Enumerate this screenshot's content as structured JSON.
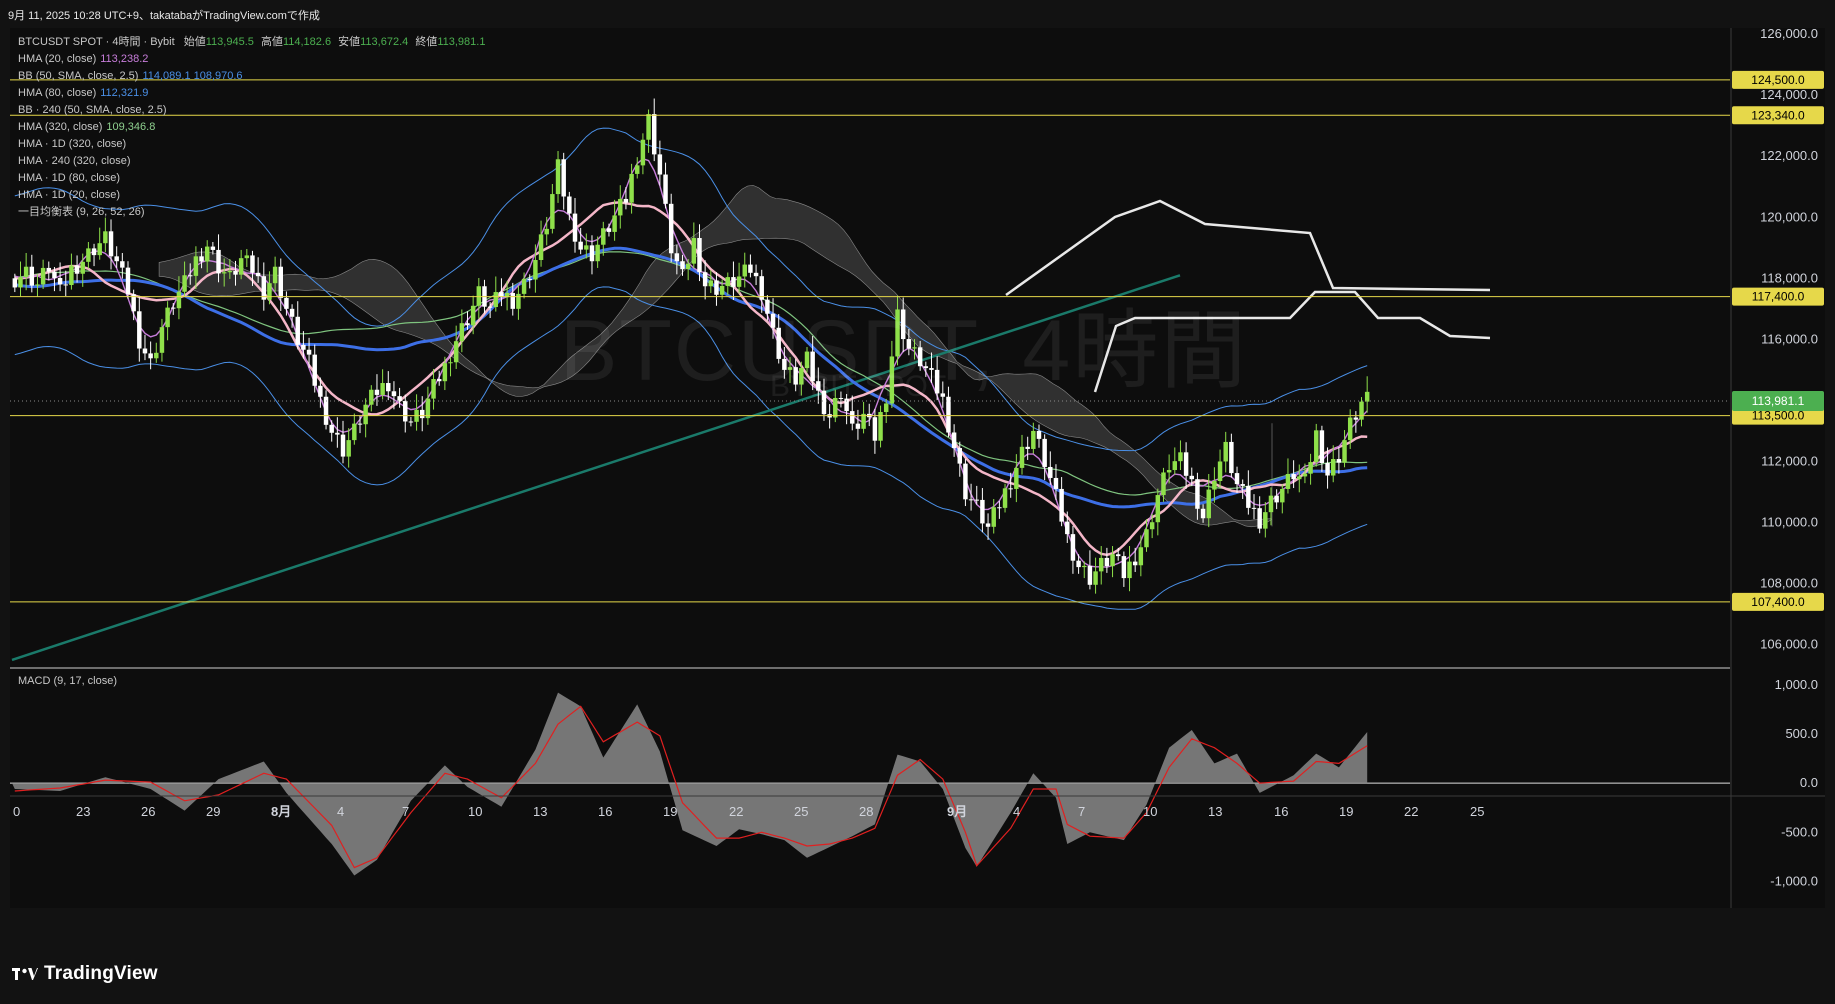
{
  "header": {
    "created_text": "9月 11, 2025 10:28 UTC+9、takatabaがTradingView.comで作成"
  },
  "symbol": {
    "title": "BTCUSDT SPOT · 4時間 · Bybit",
    "open_label": "始値",
    "open": "113,945.5",
    "high_label": "高値",
    "high": "114,182.6",
    "low_label": "安値",
    "low": "113,672.4",
    "close_label": "終値",
    "close": "113,981.1"
  },
  "watermark": {
    "main": "BTCUSDT, 4時間",
    "sub": "BYBIT SPOT"
  },
  "indicators": [
    {
      "label": "HMA (20, close)",
      "value": "113,238.2",
      "color": "#c77dda"
    },
    {
      "label": "BB (50, SMA, close, 2.5)",
      "value": "114,089.1  108,970.6",
      "color": "#4a8fe6"
    },
    {
      "label": "HMA (80, close)",
      "value": "112,321.9",
      "color": "#4a8fe6"
    },
    {
      "label": "BB · 240 (50, SMA, close, 2.5)",
      "value": "",
      "color": "#c8c8c8"
    },
    {
      "label": "HMA (320, close)",
      "value": "109,346.8",
      "color": "#8fd08f"
    },
    {
      "label": "HMA · 1D (320, close)",
      "value": "",
      "color": "#c8c8c8"
    },
    {
      "label": "HMA · 240 (320, close)",
      "value": "",
      "color": "#c8c8c8"
    },
    {
      "label": "HMA · 1D (80, close)",
      "value": "",
      "color": "#c8c8c8"
    },
    {
      "label": "HMA · 1D (20, close)",
      "value": "",
      "color": "#c8c8c8"
    },
    {
      "label": "一目均衡表 (9, 26, 52, 26)",
      "value": "",
      "color": "#c8c8c8"
    }
  ],
  "macd_label": "MACD (9, 17, close)",
  "footer": {
    "brand": "TradingView"
  },
  "colors": {
    "up": "#8fe04a",
    "down": "#ffffff",
    "hline": "#e6d84a",
    "hma_fast": "#c77dda",
    "hma_slow": "#3d6fe6",
    "hma_pink": "#f4b6c8",
    "bb": "#4a8fe6",
    "green_ma": "#7fc47f",
    "teal": "#1a7a6a",
    "cloud": "#5a5a5a",
    "white_proj": "#e8e8e8",
    "macd_signal": "#e02020",
    "macd_hist": "#8a8a8a",
    "price_badge": "#4caf50"
  },
  "chart_data": {
    "type": "candlestick",
    "timeframe": "4h",
    "x_ticks": [
      "0",
      "23",
      "26",
      "29",
      "8月",
      "4",
      "7",
      "10",
      "13",
      "16",
      "19",
      "22",
      "25",
      "28",
      "9月",
      "4",
      "7",
      "10",
      "13",
      "16",
      "19",
      "22",
      "25"
    ],
    "y_ticks": [
      "126,000.0",
      "124,000.0",
      "122,000.0",
      "120,000.0",
      "118,000.0",
      "116,000.0",
      "112,000.0",
      "110,000.0",
      "108,000.0",
      "106,000.0"
    ],
    "ylim": [
      105300,
      126200
    ],
    "horizontal_levels": [
      124500,
      123340,
      117400,
      113500,
      107400
    ],
    "level_labels": [
      "124,500.0",
      "123,340.0",
      "117,400.0",
      "113,500.0",
      "107,400.0"
    ],
    "last_price": 113981.1,
    "last_price_label": "113,981.1",
    "close_path": [
      [
        0,
        118000
      ],
      [
        2,
        118200
      ],
      [
        4,
        117800
      ],
      [
        6,
        118400
      ],
      [
        8,
        117500
      ],
      [
        10,
        118300
      ],
      [
        12,
        118600
      ],
      [
        14,
        119000
      ],
      [
        16,
        119300
      ],
      [
        18,
        118500
      ],
      [
        20,
        117600
      ],
      [
        22,
        116000
      ],
      [
        24,
        115200
      ],
      [
        26,
        116400
      ],
      [
        28,
        117200
      ],
      [
        30,
        117800
      ],
      [
        32,
        118600
      ],
      [
        34,
        119100
      ],
      [
        36,
        118400
      ],
      [
        38,
        118000
      ],
      [
        40,
        118600
      ],
      [
        42,
        118300
      ],
      [
        44,
        117600
      ],
      [
        46,
        118200
      ],
      [
        48,
        117000
      ],
      [
        50,
        116000
      ],
      [
        52,
        115200
      ],
      [
        54,
        114000
      ],
      [
        56,
        113000
      ],
      [
        58,
        112400
      ],
      [
        60,
        113000
      ],
      [
        62,
        113800
      ],
      [
        64,
        114300
      ],
      [
        66,
        114600
      ],
      [
        68,
        113800
      ],
      [
        70,
        113300
      ],
      [
        72,
        113600
      ],
      [
        74,
        114400
      ],
      [
        76,
        115100
      ],
      [
        78,
        116000
      ],
      [
        80,
        116700
      ],
      [
        82,
        117500
      ],
      [
        84,
        117000
      ],
      [
        86,
        117500
      ],
      [
        88,
        117300
      ],
      [
        90,
        117800
      ],
      [
        92,
        118600
      ],
      [
        94,
        119800
      ],
      [
        96,
        121600
      ],
      [
        98,
        120000
      ],
      [
        100,
        119000
      ],
      [
        102,
        118800
      ],
      [
        104,
        119400
      ],
      [
        106,
        120000
      ],
      [
        108,
        120600
      ],
      [
        110,
        122000
      ],
      [
        112,
        123200
      ],
      [
        114,
        121400
      ],
      [
        116,
        119000
      ],
      [
        118,
        118000
      ],
      [
        120,
        119200
      ],
      [
        122,
        117800
      ],
      [
        124,
        117700
      ],
      [
        126,
        117800
      ],
      [
        128,
        118000
      ],
      [
        130,
        118300
      ],
      [
        132,
        117600
      ],
      [
        134,
        116200
      ],
      [
        136,
        115000
      ],
      [
        138,
        114700
      ],
      [
        140,
        115300
      ],
      [
        142,
        114200
      ],
      [
        144,
        113500
      ],
      [
        146,
        114300
      ],
      [
        148,
        113000
      ],
      [
        150,
        113500
      ],
      [
        152,
        112800
      ],
      [
        154,
        114200
      ],
      [
        156,
        116800
      ],
      [
        158,
        115700
      ],
      [
        160,
        115300
      ],
      [
        162,
        114700
      ],
      [
        164,
        114000
      ],
      [
        166,
        112500
      ],
      [
        168,
        111000
      ],
      [
        170,
        110500
      ],
      [
        172,
        109800
      ],
      [
        174,
        110600
      ],
      [
        176,
        111400
      ],
      [
        178,
        112300
      ],
      [
        180,
        113000
      ],
      [
        182,
        112000
      ],
      [
        184,
        110800
      ],
      [
        186,
        109500
      ],
      [
        188,
        108600
      ],
      [
        190,
        108200
      ],
      [
        192,
        108600
      ],
      [
        194,
        108900
      ],
      [
        196,
        108300
      ],
      [
        198,
        108900
      ],
      [
        200,
        109600
      ],
      [
        202,
        110900
      ],
      [
        204,
        111900
      ],
      [
        206,
        112000
      ],
      [
        208,
        111300
      ],
      [
        210,
        110200
      ],
      [
        212,
        111600
      ],
      [
        214,
        112400
      ],
      [
        216,
        111200
      ],
      [
        218,
        110600
      ],
      [
        220,
        110100
      ],
      [
        222,
        110700
      ],
      [
        224,
        111100
      ],
      [
        226,
        111600
      ],
      [
        228,
        111300
      ],
      [
        230,
        112900
      ],
      [
        232,
        111600
      ],
      [
        234,
        112200
      ],
      [
        236,
        113200
      ],
      [
        238,
        113900
      ],
      [
        239,
        113981
      ]
    ],
    "macd_ylim": [
      -1250,
      1150
    ],
    "macd_ticks": [
      "1,000.0",
      "500.0",
      "0.0",
      "-500.0",
      "-1,000.0"
    ],
    "macd_hist": [
      [
        0,
        -60
      ],
      [
        8,
        -80
      ],
      [
        16,
        60
      ],
      [
        24,
        -60
      ],
      [
        30,
        -280
      ],
      [
        36,
        40
      ],
      [
        44,
        220
      ],
      [
        48,
        -100
      ],
      [
        56,
        -620
      ],
      [
        60,
        -940
      ],
      [
        64,
        -780
      ],
      [
        70,
        -180
      ],
      [
        76,
        180
      ],
      [
        80,
        -40
      ],
      [
        86,
        -240
      ],
      [
        92,
        340
      ],
      [
        96,
        920
      ],
      [
        100,
        780
      ],
      [
        104,
        260
      ],
      [
        110,
        800
      ],
      [
        114,
        320
      ],
      [
        118,
        -480
      ],
      [
        124,
        -640
      ],
      [
        128,
        -470
      ],
      [
        132,
        -520
      ],
      [
        136,
        -580
      ],
      [
        140,
        -760
      ],
      [
        144,
        -650
      ],
      [
        148,
        -540
      ],
      [
        152,
        -420
      ],
      [
        156,
        290
      ],
      [
        160,
        220
      ],
      [
        164,
        -60
      ],
      [
        168,
        -660
      ],
      [
        170,
        -850
      ],
      [
        176,
        -300
      ],
      [
        180,
        100
      ],
      [
        184,
        -150
      ],
      [
        186,
        -620
      ],
      [
        190,
        -500
      ],
      [
        196,
        -580
      ],
      [
        200,
        -220
      ],
      [
        204,
        360
      ],
      [
        208,
        540
      ],
      [
        212,
        200
      ],
      [
        216,
        300
      ],
      [
        220,
        -100
      ],
      [
        226,
        80
      ],
      [
        230,
        300
      ],
      [
        234,
        160
      ],
      [
        239,
        520
      ]
    ],
    "macd_signal": [
      [
        0,
        -80
      ],
      [
        8,
        -50
      ],
      [
        16,
        30
      ],
      [
        24,
        10
      ],
      [
        30,
        -180
      ],
      [
        36,
        -120
      ],
      [
        44,
        100
      ],
      [
        48,
        40
      ],
      [
        56,
        -430
      ],
      [
        60,
        -860
      ],
      [
        64,
        -760
      ],
      [
        70,
        -300
      ],
      [
        76,
        100
      ],
      [
        80,
        40
      ],
      [
        86,
        -150
      ],
      [
        92,
        200
      ],
      [
        96,
        600
      ],
      [
        100,
        780
      ],
      [
        104,
        420
      ],
      [
        110,
        620
      ],
      [
        114,
        480
      ],
      [
        118,
        -200
      ],
      [
        124,
        -560
      ],
      [
        128,
        -560
      ],
      [
        132,
        -500
      ],
      [
        136,
        -560
      ],
      [
        140,
        -640
      ],
      [
        144,
        -620
      ],
      [
        148,
        -560
      ],
      [
        152,
        -460
      ],
      [
        156,
        80
      ],
      [
        160,
        240
      ],
      [
        164,
        40
      ],
      [
        168,
        -500
      ],
      [
        170,
        -840
      ],
      [
        176,
        -460
      ],
      [
        180,
        -60
      ],
      [
        184,
        -60
      ],
      [
        186,
        -420
      ],
      [
        190,
        -540
      ],
      [
        196,
        -560
      ],
      [
        200,
        -300
      ],
      [
        204,
        160
      ],
      [
        208,
        450
      ],
      [
        212,
        360
      ],
      [
        216,
        200
      ],
      [
        220,
        0
      ],
      [
        226,
        20
      ],
      [
        230,
        220
      ],
      [
        234,
        200
      ],
      [
        239,
        380
      ]
    ]
  }
}
